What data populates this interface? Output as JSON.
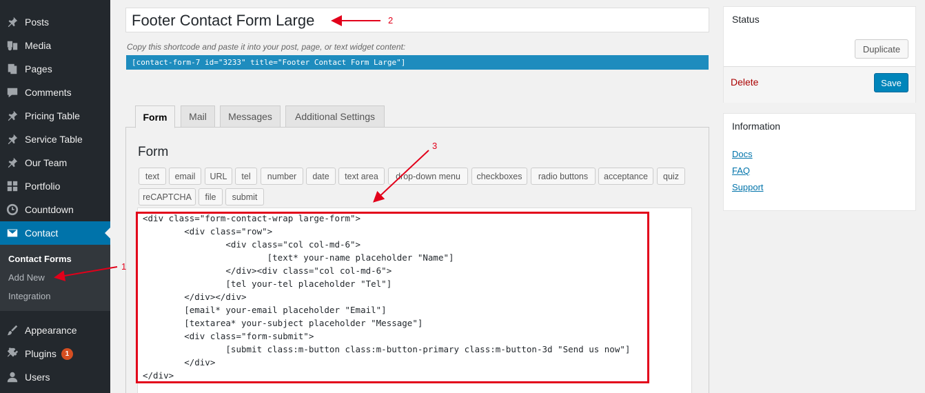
{
  "sidebar": {
    "items": [
      {
        "label": "Posts",
        "icon": "pin-icon"
      },
      {
        "label": "Media",
        "icon": "media-icon"
      },
      {
        "label": "Pages",
        "icon": "pages-icon"
      },
      {
        "label": "Comments",
        "icon": "comment-icon"
      },
      {
        "label": "Pricing Table",
        "icon": "pin-icon"
      },
      {
        "label": "Service Table",
        "icon": "pin-icon"
      },
      {
        "label": "Our Team",
        "icon": "pin-icon"
      },
      {
        "label": "Portfolio",
        "icon": "grid-icon"
      },
      {
        "label": "Countdown",
        "icon": "clock-icon"
      },
      {
        "label": "Contact",
        "icon": "mail-icon"
      },
      {
        "label": "Appearance",
        "icon": "brush-icon"
      },
      {
        "label": "Plugins",
        "icon": "plug-icon"
      },
      {
        "label": "Users",
        "icon": "user-icon"
      }
    ],
    "submenu": [
      "Contact Forms",
      "Add New",
      "Integration"
    ],
    "plugins_badge": "1"
  },
  "form": {
    "title": "Footer Contact Form Large",
    "shortcode_help": "Copy this shortcode and paste it into your post, page, or text widget content:",
    "shortcode": "[contact-form-7 id=\"3233\" title=\"Footer Contact Form Large\"]"
  },
  "tabs": [
    "Form",
    "Mail",
    "Messages",
    "Additional Settings"
  ],
  "panel": {
    "title": "Form",
    "tag_buttons_row1": [
      "text",
      "email",
      "URL",
      "tel",
      "number",
      "date",
      "text area",
      "drop-down menu",
      "checkboxes",
      "radio buttons",
      "acceptance",
      "quiz"
    ],
    "tag_buttons_row2": [
      "reCAPTCHA",
      "file",
      "submit"
    ],
    "code": "<div class=\"form-contact-wrap large-form\">\n        <div class=\"row\">\n                <div class=\"col col-md-6\">\n                        [text* your-name placeholder \"Name\"]\n                </div><div class=\"col col-md-6\">\n                [tel your-tel placeholder \"Tel\"]\n        </div></div>\n        [email* your-email placeholder \"Email\"]\n        [textarea* your-subject placeholder \"Message\"]\n        <div class=\"form-submit\">\n                [submit class:m-button class:m-button-primary class:m-button-3d \"Send us now\"]\n        </div>\n</div>"
  },
  "status_box": {
    "title": "Status",
    "duplicate_label": "Duplicate",
    "delete_label": "Delete",
    "save_label": "Save"
  },
  "info_box": {
    "title": "Information",
    "links": [
      "Docs",
      "FAQ",
      "Support"
    ]
  },
  "annotations": [
    "1",
    "2",
    "3"
  ],
  "colors": {
    "sidebar_bg": "#23282d",
    "active_blue": "#0073aa",
    "annotation_red": "#e2001a",
    "delete_red": "#a00"
  }
}
